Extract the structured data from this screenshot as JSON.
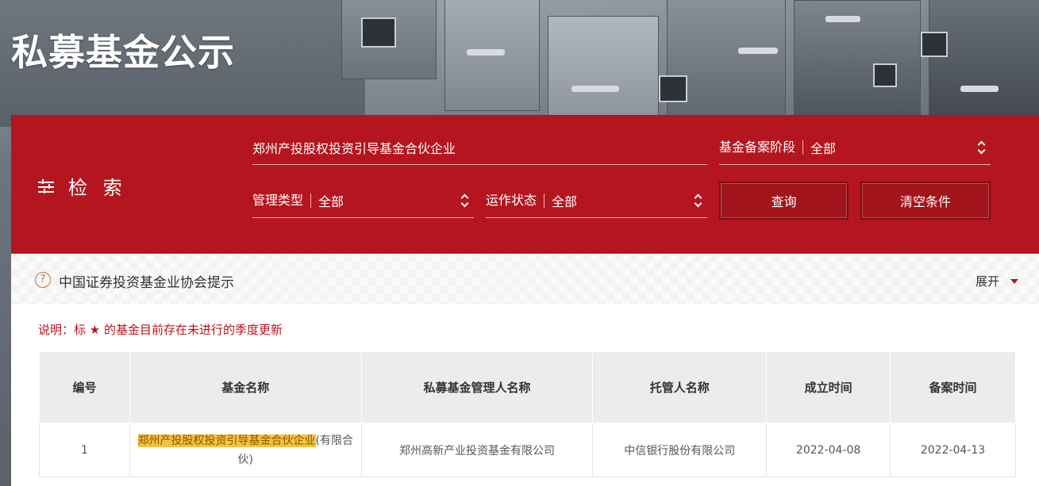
{
  "page": {
    "title": "私募基金公示"
  },
  "search": {
    "heading": "检 索",
    "fund_name_value": "郑州产投股权投资引导基金合伙企业",
    "stage_label": "基金备案阶段",
    "stage_value": "全部",
    "type_label": "管理类型",
    "type_value": "全部",
    "status_label": "运作状态",
    "status_value": "全部",
    "query_button": "查询",
    "clear_button": "清空条件"
  },
  "notice": {
    "text": "中国证券投资基金业协会提示",
    "expand_label": "展开",
    "help_glyph": "?"
  },
  "legend_note": "说明：标 ★ 的基金目前存在未进行的季度更新",
  "table": {
    "headers": [
      "编号",
      "基金名称",
      "私募基金管理人名称",
      "托管人名称",
      "成立时间",
      "备案时间"
    ],
    "rows": [
      {
        "no": "1",
        "fund_name_highlight": "郑州产投股权投资引导基金合伙企业",
        "fund_name_rest": "(有限合伙)",
        "manager": "郑州高新产业投资基金有限公司",
        "custodian": "中信银行股份有限公司",
        "established": "2022-04-08",
        "filed": "2022-04-13"
      }
    ]
  },
  "colors": {
    "brand_red": "#b5151f",
    "highlight": "#f6c23e"
  }
}
